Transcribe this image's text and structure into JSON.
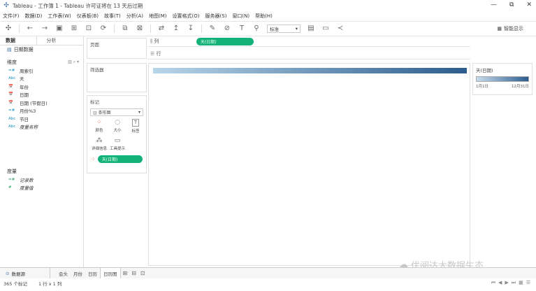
{
  "window": {
    "title": "Tableau - 工作簿 1 - Tableau 许可证将在 13 天后过期",
    "controls": [
      "—",
      "⧉",
      "✕"
    ]
  },
  "menu": [
    "文件(F)",
    "数据(D)",
    "工作表(W)",
    "仪表板(B)",
    "故事(T)",
    "分析(A)",
    "地图(M)",
    "设置格式(O)",
    "服务器(S)",
    "窗口(N)",
    "帮助(H)"
  ],
  "toolbar": {
    "fit_select": "标准",
    "smart_show": "智能显示"
  },
  "data_pane": {
    "tab_data": "数据",
    "tab_analysis": "分析",
    "datasource": "日期数据",
    "dimensions_header": "维度",
    "dimensions": [
      {
        "icon": "=#",
        "label": "周索引",
        "italic": false
      },
      {
        "icon": "Abc",
        "label": "天",
        "italic": false
      },
      {
        "icon": "📅",
        "label": "年份",
        "italic": false
      },
      {
        "icon": "📅",
        "label": "日期",
        "italic": false
      },
      {
        "icon": "📅",
        "label": "日期 (节假日)",
        "italic": false
      },
      {
        "icon": "=#",
        "label": "月份%3",
        "italic": false
      },
      {
        "icon": "Abc",
        "label": "节日",
        "italic": false
      },
      {
        "icon": "Abc",
        "label": "度量名称",
        "italic": true
      }
    ],
    "measures_header": "度量",
    "measures": [
      {
        "icon": "=#",
        "label": "记录数",
        "italic": true
      },
      {
        "icon": "#",
        "label": "度量值",
        "italic": true
      }
    ]
  },
  "cards": {
    "pages": "页面",
    "filters": "筛选器",
    "marks": "标记",
    "mark_type": "条形图",
    "mark_buttons": [
      {
        "icon": "⁘",
        "label": "颜色"
      },
      {
        "icon": "◌",
        "label": "大小"
      },
      {
        "icon": "T",
        "label": "标签"
      },
      {
        "icon": "⁂",
        "label": "详细信息"
      },
      {
        "icon": "▭",
        "label": "工具提示"
      }
    ],
    "marks_pill": "天(日期)"
  },
  "shelves": {
    "columns_label": "列",
    "columns_pill": "天(日期)",
    "rows_label": "行"
  },
  "legend": {
    "title": "天(日期)",
    "min": "1月1日",
    "max": "12月31日",
    "color_start": "#c7dcec",
    "color_end": "#2c5c8e"
  },
  "sheet_tabs": {
    "datasource": "数据源",
    "sheets": [
      "会头",
      "月份",
      "日历",
      "日历图"
    ],
    "active": "日历图"
  },
  "status": {
    "marks": "365 个标记",
    "dims": "1 行 x 1 列"
  },
  "watermark": "优阅达大数据生态",
  "colors": {
    "pill": "#14b27a",
    "accent": "#2c5c8e"
  }
}
